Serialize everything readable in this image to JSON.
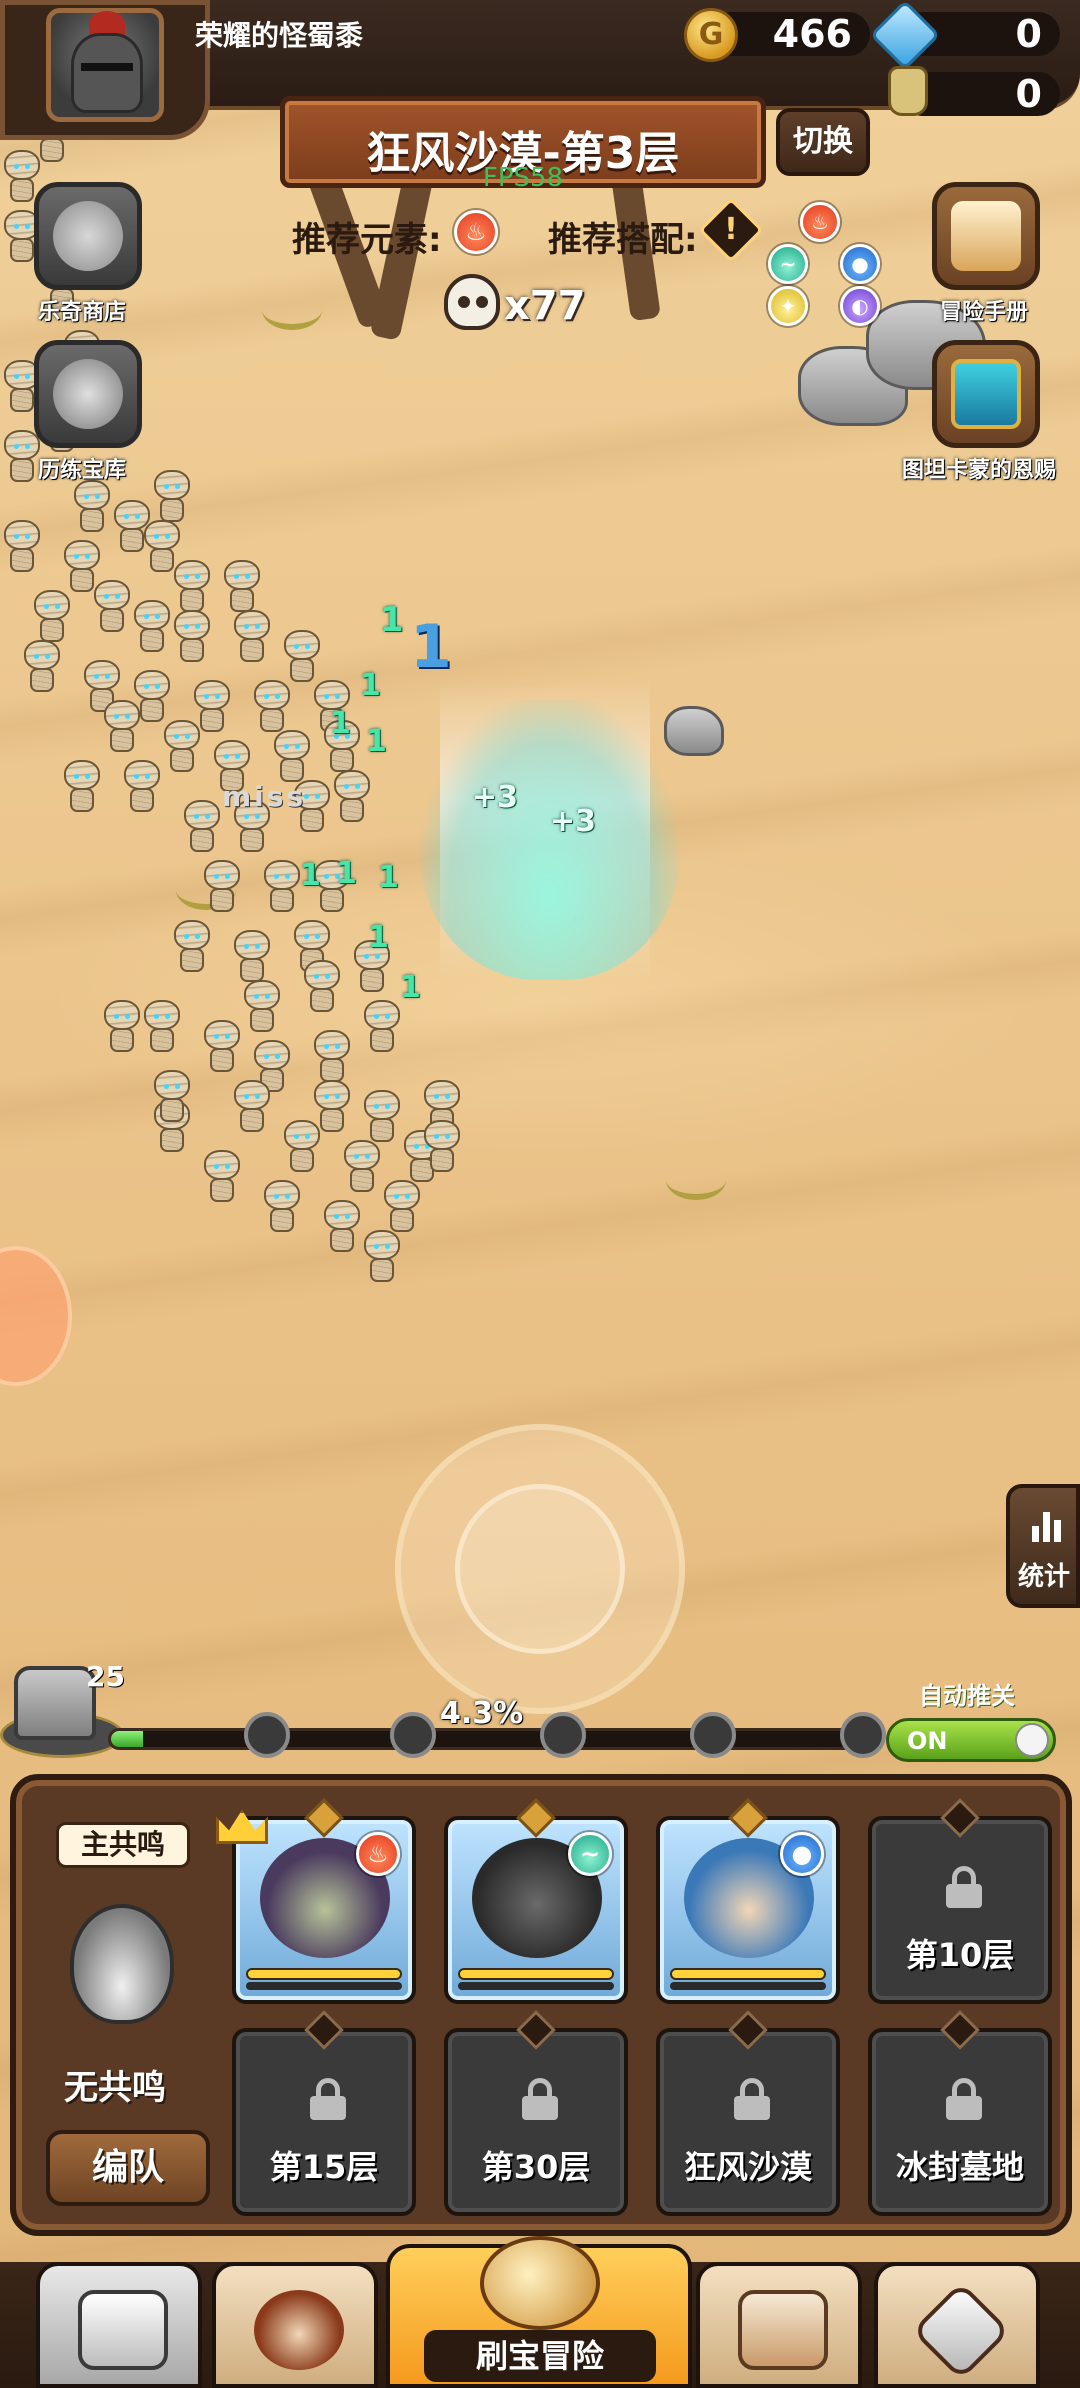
{
  "player": {
    "name": "荣耀的怪蜀黍"
  },
  "resources": {
    "gold": "466",
    "gems": "0",
    "potions": "0"
  },
  "stage": {
    "title": "狂风沙漠-第3层",
    "fps": "FPS58",
    "switch_label": "切换",
    "recommended_element_label": "推荐元素:",
    "recommended_combo_label": "推荐搭配:",
    "kill_count": "x77"
  },
  "side_buttons": {
    "shop_label": "乐奇商店",
    "vault_label": "历练宝库",
    "handbook_label": "冒险手册",
    "gift_label": "图坦卡蒙的恩赐",
    "stats_label": "统计"
  },
  "combat": {
    "miss_text": "miss",
    "damage_numbers": [
      "1",
      "1",
      "1",
      "1",
      "1",
      "1",
      "1",
      "1",
      "1",
      "1",
      "+3",
      "+3"
    ]
  },
  "progress": {
    "chest_count": "25",
    "percent_label": "4.3%",
    "fraction": 0.043
  },
  "auto_push": {
    "label": "自动推关",
    "state": "ON"
  },
  "team": {
    "resonance_tag": "主共鸣",
    "resonance_status": "无共鸣",
    "formation_button": "编队",
    "locked_slots": [
      "第10层",
      "第15层",
      "第30层",
      "狂风沙漠",
      "冰封墓地"
    ]
  },
  "nav": {
    "main_label": "刷宝冒险"
  },
  "colors": {
    "sand": "#ebc58c",
    "accent_orange": "#f59a1e",
    "panel_brown": "#5a3a24",
    "heal_green": "#46e6a8"
  },
  "icons": {
    "gold": "coin-icon",
    "gems": "gem-icon",
    "potion": "potion-jar-icon",
    "kills": "skull-icon",
    "stats": "bar-chart-icon",
    "lock": "lock-icon"
  }
}
